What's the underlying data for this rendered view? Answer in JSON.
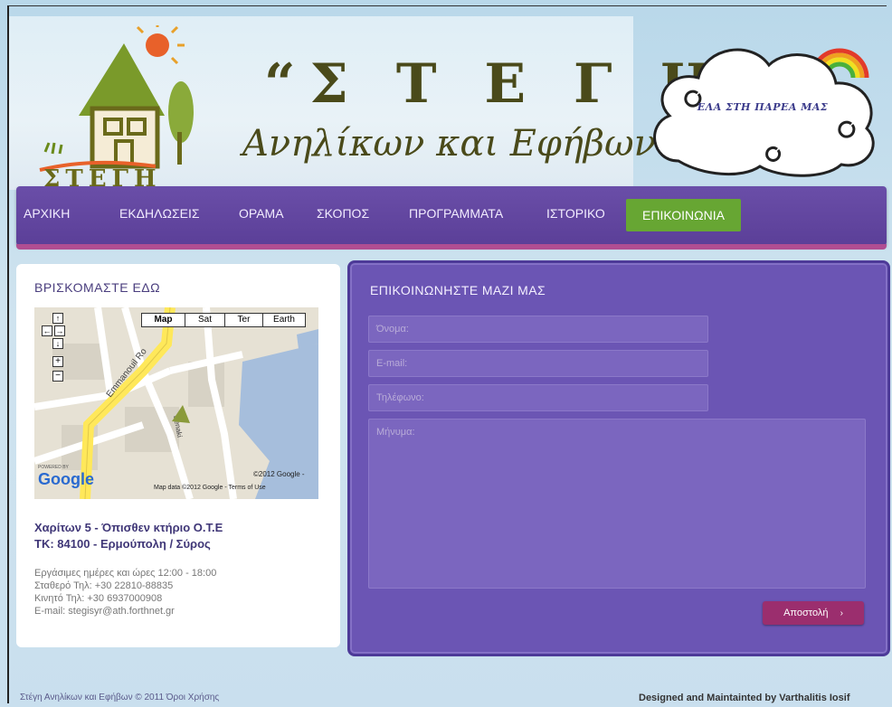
{
  "header": {
    "logo_text": "ΣΤΕΓΗ",
    "title_main": "“Σ Τ Ε Γ Η”",
    "title_sub": "Ανηλίκων και Εφήβων",
    "cloud_text": "ΕΛΑ ΣΤΗ ΠΑΡΕΑ ΜΑΣ"
  },
  "nav": {
    "items": [
      {
        "label": "ΑΡΧΙΚΗ"
      },
      {
        "label": "ΕΚΔΗΛΩΣΕΙΣ"
      },
      {
        "label": "ΟΡΑΜΑ"
      },
      {
        "label": "ΣΚΟΠΟΣ"
      },
      {
        "label": "ΠΡΟΓΡΑΜΜΑΤΑ"
      },
      {
        "label": "ΙΣΤΟΡΙΚΟ"
      },
      {
        "label": "ΕΠΙΚΟΙΝΩΝΙΑ"
      }
    ],
    "active_color": "#67a633"
  },
  "location": {
    "title": "ΒΡΙΣΚΟΜΑΣΤΕ ΕΔΩ",
    "map": {
      "buttons": [
        "Map",
        "Sat",
        "Ter",
        "Earth"
      ],
      "street1": "Emmanouil Ro",
      "street2": "Benaki",
      "powered_by": "POWERED BY",
      "google": "Google",
      "copyright": "©2012 Google -",
      "map_data": "Map data ©2012 Google - Terms of Use"
    },
    "address_line1": "Χαρίτων 5 - Όπισθεν κτήριο Ο.Τ.Ε",
    "address_line2": "ΤΚ: 84100 - Ερμούπολη / Σύρος",
    "hours": "Εργάσιμες ημέρες και ώρες 12:00 - 18:00",
    "phone": "Σταθερό Τηλ:   +30 22810-88835",
    "mobile": "Κινητό Τηλ:    +30 6937000908",
    "email": "E-mail: stegisyr@ath.forthnet.gr"
  },
  "contact": {
    "title": "ΕΠΙΚΟΙΝΩΝΗΣΤΕ ΜΑΖΙ ΜΑΣ",
    "name_placeholder": "Όνομα:",
    "email_placeholder": "E-mail:",
    "phone_placeholder": "Τηλέφωνο:",
    "message_placeholder": "Μήνυμα:",
    "send_label": "Αποστολή"
  },
  "footer": {
    "left": "Στέγη Ανηλίκων και Εφήβων © 2011   Όροι Χρήσης",
    "right": "Designed and Maintainted by Varthalitis Iosif"
  }
}
